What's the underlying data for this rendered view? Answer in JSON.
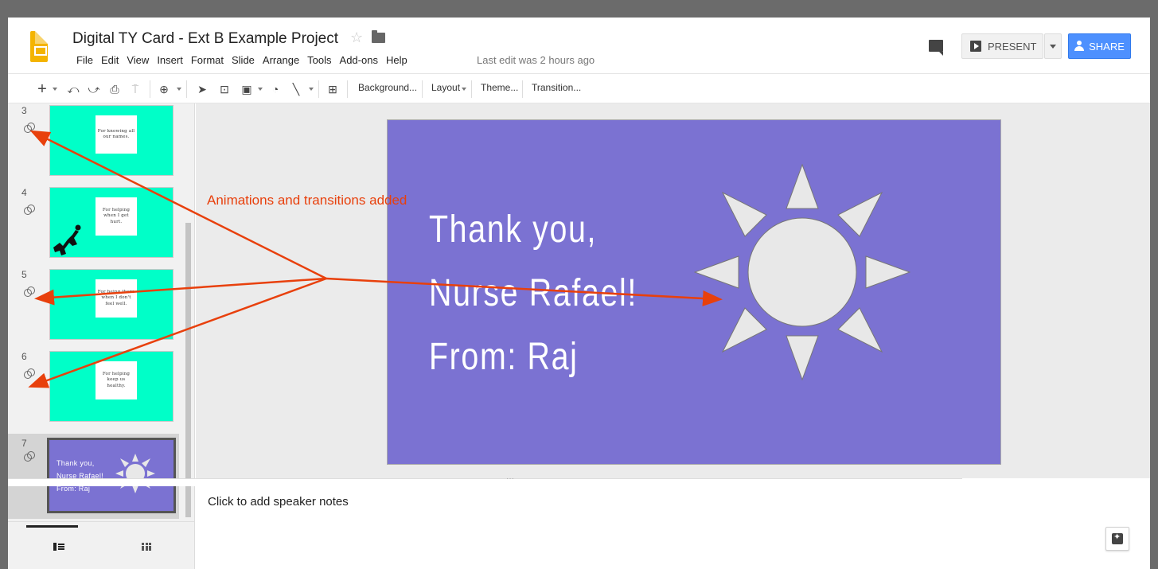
{
  "header": {
    "doc_title": "Digital TY Card - Ext B Example Project",
    "menu": [
      "File",
      "Edit",
      "View",
      "Insert",
      "Format",
      "Slide",
      "Arrange",
      "Tools",
      "Add-ons",
      "Help"
    ],
    "last_edit": "Last edit was 2 hours ago",
    "present_label": "PRESENT",
    "share_label": "SHARE",
    "brand_color": "#f4b400",
    "share_color": "#4d90fe"
  },
  "toolbar": {
    "icons": [
      "add-icon",
      "undo-icon",
      "redo-icon",
      "print-icon",
      "paint-format-icon",
      "zoom-icon",
      "select-icon",
      "text-box-icon",
      "image-icon",
      "shape-icon",
      "line-icon",
      "comment-icon"
    ],
    "background_label": "Background...",
    "layout_label": "Layout",
    "theme_label": "Theme...",
    "transition_label": "Transition..."
  },
  "filmstrip": {
    "slides": [
      {
        "number": "3",
        "text": "For knowing all our names."
      },
      {
        "number": "4",
        "text": "For helping when I get hurt."
      },
      {
        "number": "5",
        "text": "For being there when I don't feel well."
      },
      {
        "number": "6",
        "text": "For helping keep us healthy."
      },
      {
        "number": "7",
        "lines": [
          "Thank you,",
          "Nurse Rafael!",
          "From: Raj"
        ]
      }
    ],
    "thumb_color": "#00ffc8"
  },
  "slide": {
    "lines": [
      "Thank you,",
      "Nurse Rafael!",
      "From: Raj"
    ],
    "background": "#7b72d2",
    "sun_color": "#e8e8e8"
  },
  "notes": {
    "placeholder": "Click to add speaker notes"
  },
  "annotation": {
    "text": "Animations and transitions added",
    "color": "#e8400c"
  }
}
